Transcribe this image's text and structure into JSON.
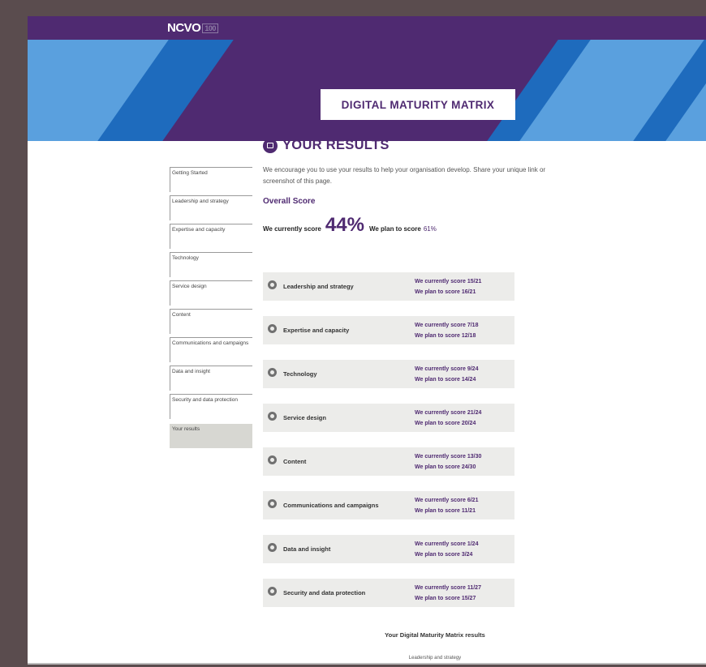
{
  "header": {
    "logo_text": "NCVO",
    "logo_badge": "100",
    "banner_title": "DIGITAL MATURITY MATRIX",
    "colors": {
      "purple": "#4f2a71",
      "light_blue": "#5aa0de",
      "dark_blue": "#1e6bbd"
    }
  },
  "sidebar": {
    "items": [
      {
        "label": "Getting Started"
      },
      {
        "label": "Leadership and strategy"
      },
      {
        "label": "Expertise and capacity"
      },
      {
        "label": "Technology"
      },
      {
        "label": "Service design"
      },
      {
        "label": "Content"
      },
      {
        "label": "Communications and campaigns"
      },
      {
        "label": "Data and insight"
      },
      {
        "label": "Security and data protection"
      },
      {
        "label": "Your results"
      }
    ]
  },
  "results": {
    "heading": "YOUR RESULTS",
    "intro": "We encourage you to use your results to help your organisation develop. Share your unique link or screenshot of this page.",
    "overall_label": "Overall Score",
    "current_prefix": "We currently score",
    "current_score": "44%",
    "plan_prefix": "We plan to score",
    "plan_score": "61%"
  },
  "categories": [
    {
      "name": "Leadership and strategy",
      "current": "We currently score 15/21",
      "plan": "We plan to score 16/21"
    },
    {
      "name": "Expertise and capacity",
      "current": "We currently score 7/18",
      "plan": "We plan to score 12/18"
    },
    {
      "name": "Technology",
      "current": "We currently score 9/24",
      "plan": "We plan to score 14/24"
    },
    {
      "name": "Service design",
      "current": "We currently score 21/24",
      "plan": "We plan to score 20/24"
    },
    {
      "name": "Content",
      "current": "We currently score 13/30",
      "plan": "We plan to score 24/30"
    },
    {
      "name": "Communications and campaigns",
      "current": "We currently score 6/21",
      "plan": "We plan to score 11/21"
    },
    {
      "name": "Data and insight",
      "current": "We currently score 1/24",
      "plan": "We plan to score 3/24"
    },
    {
      "name": "Security and data protection",
      "current": "We currently score 11/27",
      "plan": "We plan to score 15/27"
    }
  ],
  "footer": {
    "title": "Your Digital Maturity Matrix results",
    "chart_label": "Leadership and strategy"
  }
}
